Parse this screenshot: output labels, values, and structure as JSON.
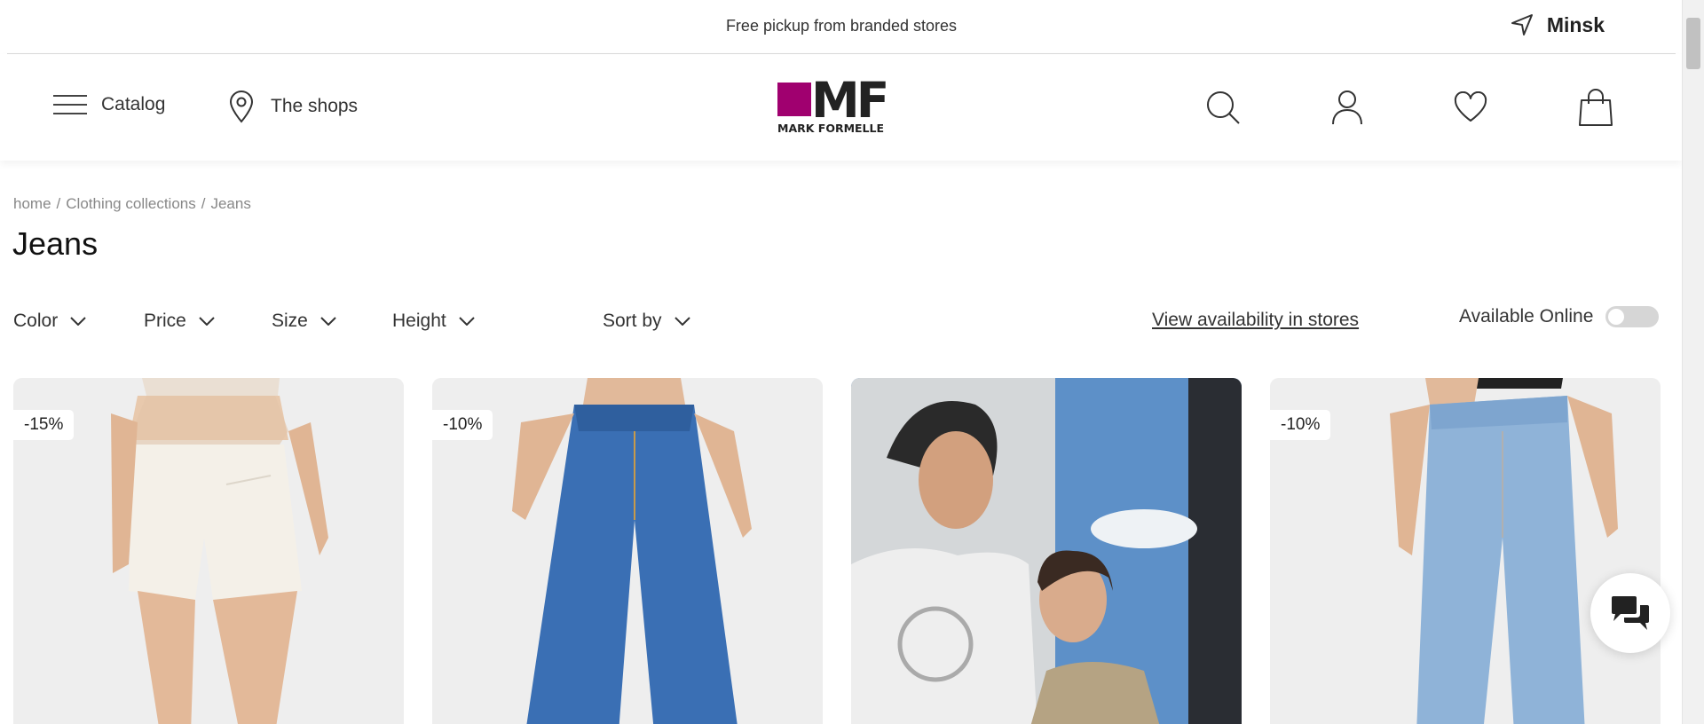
{
  "topbar": {
    "promo": "Free pickup from branded stores",
    "city": "Minsk"
  },
  "header": {
    "catalog_label": "Catalog",
    "shops_label": "The shops",
    "logo_text": "MF",
    "logo_subtext": "MARK FORMELLE",
    "brand_color": "#a0006f",
    "icons": [
      "search-icon",
      "user-icon",
      "heart-icon",
      "bag-icon"
    ]
  },
  "breadcrumb": {
    "items": [
      "home",
      "Clothing collections",
      "Jeans"
    ],
    "separator": "/"
  },
  "page": {
    "title": "Jeans"
  },
  "filters": {
    "color": "Color",
    "price": "Price",
    "size": "Size",
    "height": "Height",
    "sort": "Sort by",
    "availability_link": "View availability in stores",
    "online_label": "Available Online",
    "online_enabled": false
  },
  "products": [
    {
      "badge": "-15%"
    },
    {
      "badge": "-10%"
    },
    {
      "badge": ""
    },
    {
      "badge": "-10%"
    }
  ]
}
